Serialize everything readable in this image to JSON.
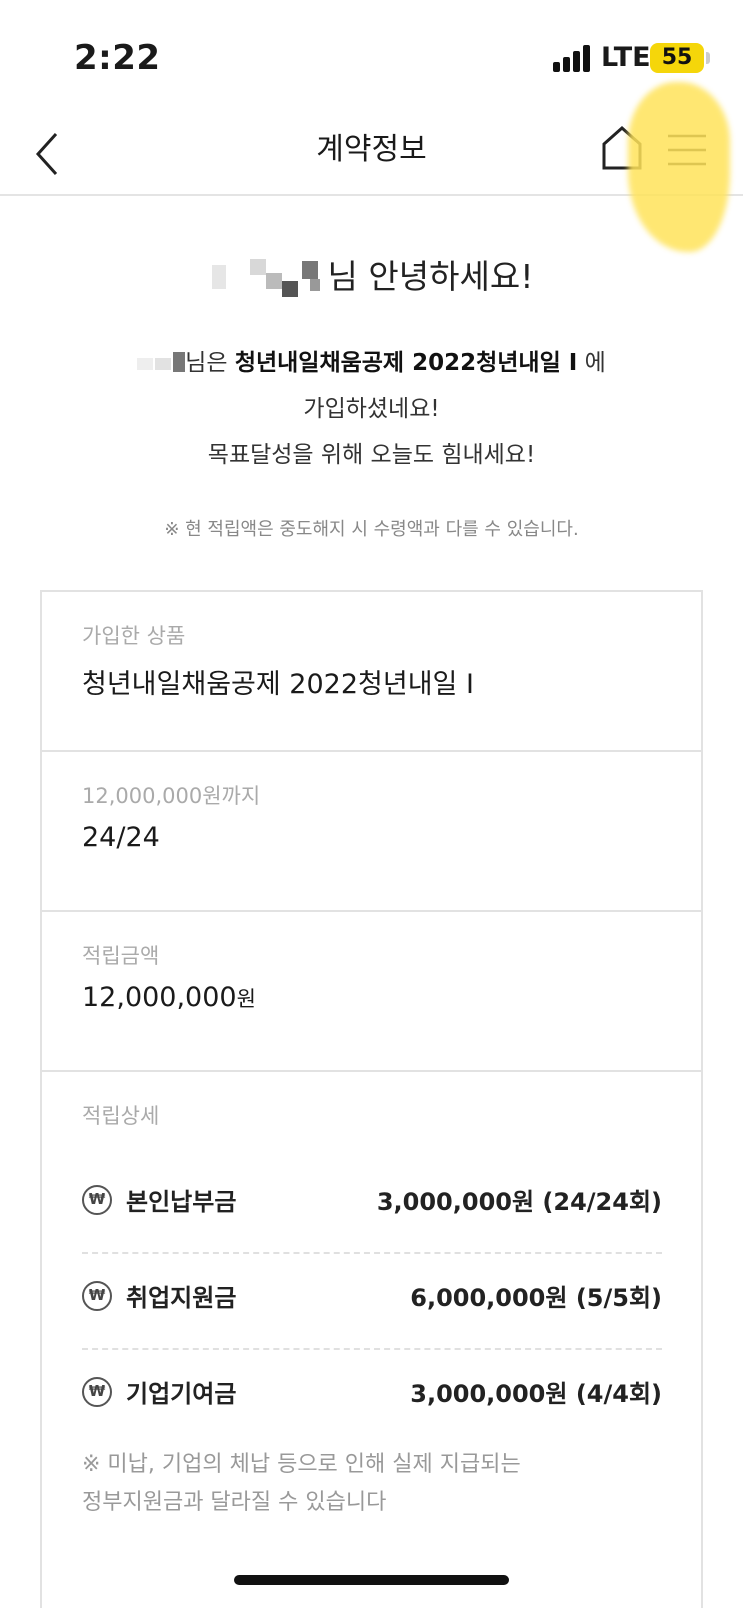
{
  "status_bar": {
    "time": "2:22",
    "network": "LTE",
    "battery": "55"
  },
  "header": {
    "title": "계약정보",
    "back_icon": "chevron-left-icon",
    "home_icon": "home-icon",
    "menu_icon": "hamburger-menu-icon"
  },
  "greeting": {
    "suffix": "님 안녕하세요!"
  },
  "message": {
    "line1_prefix": "님은 ",
    "line1_product": "청년내일채움공제 2022청년내일 I",
    "line1_suffix": " 에",
    "line2": "가입하셨네요!",
    "line3": "목표달성을 위해 오늘도 힘내세요!"
  },
  "top_notice": "※ 현 적립액은 중도해지 시 수령액과 다를 수 있습니다.",
  "sections": {
    "product": {
      "label": "가입한 상품",
      "value": "청년내일채움공제 2022청년내일 I"
    },
    "goal": {
      "label": "12,000,000원까지",
      "value": "24/24"
    },
    "saved": {
      "label": "적립금액",
      "amount": "12,000,000",
      "unit": "원"
    },
    "details": {
      "label": "적립상세",
      "rows": [
        {
          "name": "본인납부금",
          "value": "3,000,000원 (24/24회)",
          "icon": "won-coin-icon"
        },
        {
          "name": "취업지원금",
          "value": "6,000,000원 (5/5회)",
          "icon": "won-coin-icon"
        },
        {
          "name": "기업기여금",
          "value": "3,000,000원 (4/4회)",
          "icon": "won-coin-icon"
        }
      ],
      "note_line1": "※ 미납, 기업의 체납 등으로 인해 실제 지급되는",
      "note_line2": "정부지원금과 달라질 수 있습니다"
    }
  },
  "colors": {
    "highlight": "#ffe35a",
    "battery": "#f5d60a",
    "divider": "#e2e2e2"
  }
}
